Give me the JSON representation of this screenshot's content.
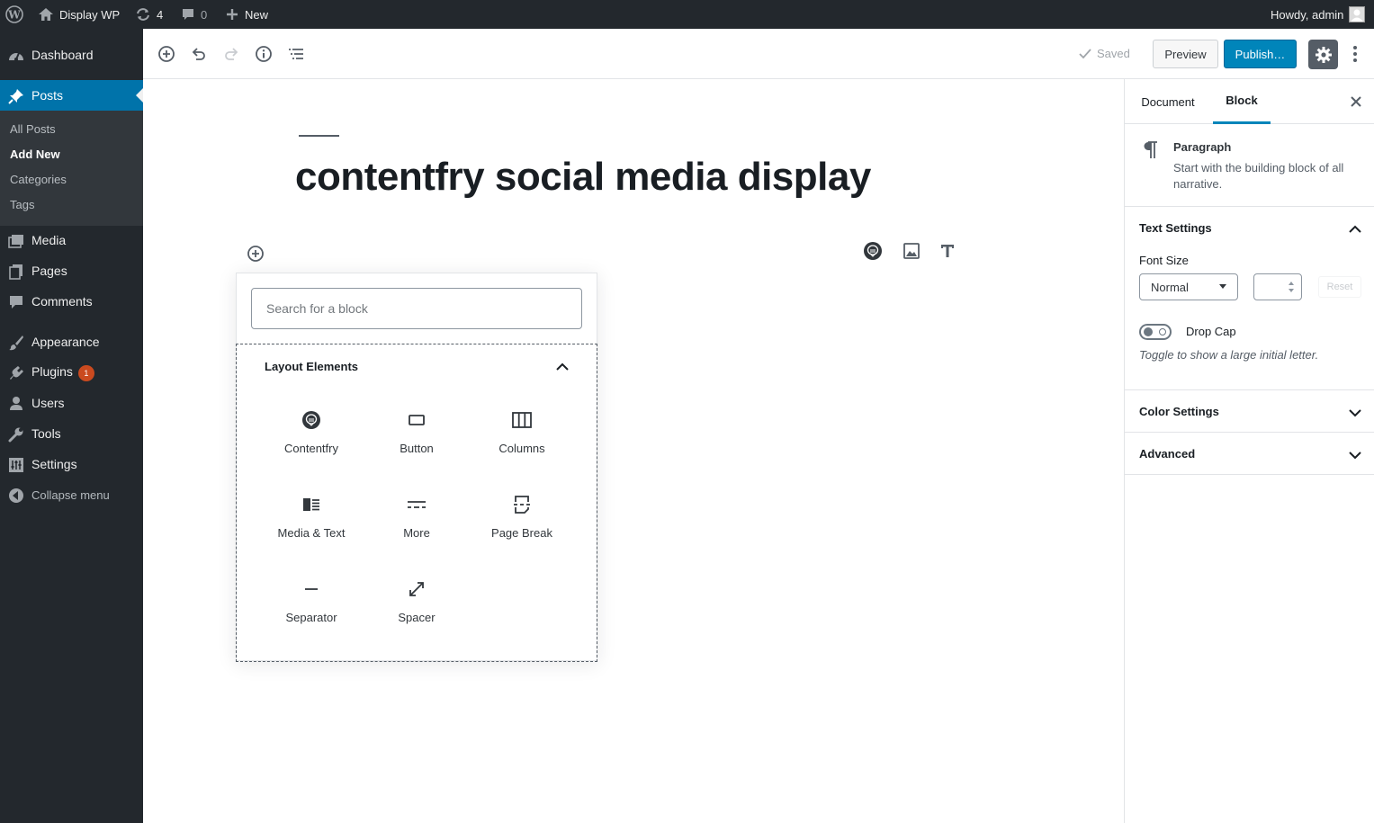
{
  "admin_bar": {
    "site_name": "Display WP",
    "updates_count": "4",
    "comments_count": "0",
    "new_label": "New",
    "howdy": "Howdy, admin"
  },
  "sidebar": {
    "items": [
      {
        "label": "Dashboard",
        "icon": "dashboard-icon"
      },
      {
        "label": "Posts",
        "icon": "pin-icon"
      },
      {
        "label": "Media",
        "icon": "media-icon"
      },
      {
        "label": "Pages",
        "icon": "pages-icon"
      },
      {
        "label": "Comments",
        "icon": "comment-icon"
      },
      {
        "label": "Appearance",
        "icon": "brush-icon"
      },
      {
        "label": "Plugins",
        "icon": "plugin-icon",
        "badge": "1"
      },
      {
        "label": "Users",
        "icon": "user-icon"
      },
      {
        "label": "Tools",
        "icon": "wrench-icon"
      },
      {
        "label": "Settings",
        "icon": "settings-icon"
      }
    ],
    "submenu": [
      "All Posts",
      "Add New",
      "Categories",
      "Tags"
    ],
    "collapse_label": "Collapse menu"
  },
  "header": {
    "saved_label": "Saved",
    "preview_label": "Preview",
    "publish_label": "Publish…"
  },
  "editor": {
    "title": "contentfry social media display"
  },
  "inserter": {
    "search_placeholder": "Search for a block",
    "panel_title": "Layout Elements",
    "blocks": [
      {
        "label": "Contentfry",
        "icon": "contentfry-icon"
      },
      {
        "label": "Button",
        "icon": "button-icon"
      },
      {
        "label": "Columns",
        "icon": "columns-icon"
      },
      {
        "label": "Media & Text",
        "icon": "media-text-icon"
      },
      {
        "label": "More",
        "icon": "more-icon"
      },
      {
        "label": "Page Break",
        "icon": "page-break-icon"
      },
      {
        "label": "Separator",
        "icon": "separator-icon"
      },
      {
        "label": "Spacer",
        "icon": "spacer-icon"
      }
    ]
  },
  "settings_sidebar": {
    "tabs": [
      "Document",
      "Block"
    ],
    "active_tab": "Block",
    "block_card": {
      "title": "Paragraph",
      "description": "Start with the building block of all narrative."
    },
    "text_settings": {
      "title": "Text Settings",
      "font_size_label": "Font Size",
      "font_size_value": "Normal",
      "reset_label": "Reset",
      "drop_cap_label": "Drop Cap",
      "drop_cap_help": "Toggle to show a large initial letter."
    },
    "color_settings_title": "Color Settings",
    "advanced_title": "Advanced"
  },
  "colors": {
    "admin_dark": "#23282d",
    "accent": "#0073aa",
    "publish": "#0085ba",
    "badge": "#ca4a1f"
  }
}
